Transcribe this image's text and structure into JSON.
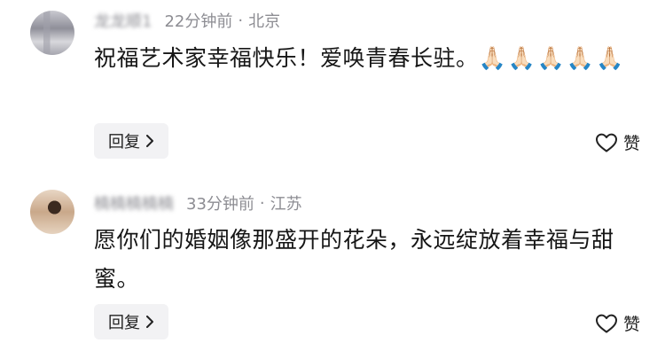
{
  "comments": [
    {
      "username": "龙龙顺1",
      "time": "22分钟前",
      "location": "北京",
      "text": "祝福艺术家幸福快乐！爱唤青春长驻。",
      "emoji": "🙏🏻🙏🏻🙏🏻🙏🏻🙏🏻",
      "reply_label": "回复",
      "like_label": "赞"
    },
    {
      "username": "楠楠楠楠楠",
      "time": "33分钟前",
      "location": "江苏",
      "text": "愿你们的婚姻像那盛开的花朵，永远绽放着幸福与甜蜜。",
      "reply_label": "回复",
      "like_label": "赞"
    }
  ],
  "separator": "·",
  "icons": {
    "reply_chevron": "chevron-right-icon",
    "like": "heart-outline-icon"
  }
}
